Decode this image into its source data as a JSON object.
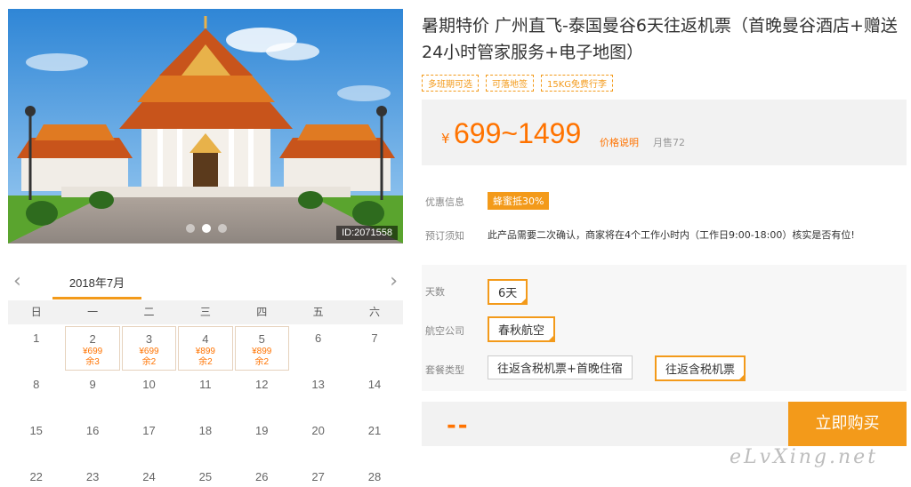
{
  "hero": {
    "id_label": "ID:2071558",
    "dots": 3,
    "active_dot": 2
  },
  "calendar": {
    "prev": "‹",
    "next": "›",
    "month": "2018年7月",
    "weekdays": [
      "日",
      "一",
      "二",
      "三",
      "四",
      "五",
      "六"
    ],
    "weeks": [
      [
        {
          "day": "1"
        },
        {
          "day": "2",
          "price": "¥699",
          "left": "余3"
        },
        {
          "day": "3",
          "price": "¥699",
          "left": "余2"
        },
        {
          "day": "4",
          "price": "¥899",
          "left": "余2"
        },
        {
          "day": "5",
          "price": "¥899",
          "left": "余2"
        },
        {
          "day": "6"
        },
        {
          "day": "7"
        }
      ],
      [
        {
          "day": "8"
        },
        {
          "day": "9"
        },
        {
          "day": "10"
        },
        {
          "day": "11"
        },
        {
          "day": "12"
        },
        {
          "day": "13"
        },
        {
          "day": "14"
        }
      ],
      [
        {
          "day": "15"
        },
        {
          "day": "16"
        },
        {
          "day": "17"
        },
        {
          "day": "18"
        },
        {
          "day": "19"
        },
        {
          "day": "20"
        },
        {
          "day": "21"
        }
      ],
      [
        {
          "day": "22"
        },
        {
          "day": "23"
        },
        {
          "day": "24"
        },
        {
          "day": "25"
        },
        {
          "day": "26"
        },
        {
          "day": "27"
        },
        {
          "day": "28"
        }
      ]
    ]
  },
  "product": {
    "title": "暑期特价 广州直飞-泰国曼谷6天往返机票（首晚曼谷酒店+赠送24小时管家服务+电子地图）",
    "tags": [
      "多班期可选",
      "可落地签",
      "15KG免费行李"
    ],
    "price_yen": "¥",
    "price_range": "699~1499",
    "price_note": "价格说明",
    "sold": "月售72"
  },
  "info": {
    "promo_label": "优惠信息",
    "promo_value": "蜂蜜抵30%",
    "notice_label": "预订须知",
    "notice_value": "此产品需要二次确认，商家将在4个工作小时内（工作日9:00-18:00）核实是否有位!"
  },
  "options": {
    "days_label": "天数",
    "days_value": "6天",
    "airline_label": "航空公司",
    "airline_value": "春秋航空",
    "package_label": "套餐类型",
    "package_options": [
      "往返含税机票+首晚住宿",
      "往返含税机票"
    ],
    "package_selected": 1
  },
  "buy": {
    "qty": "--",
    "button": "立即购买"
  },
  "watermark": "eLvXing.net",
  "colors": {
    "accent": "#f39a1a",
    "price": "#ff7300"
  }
}
